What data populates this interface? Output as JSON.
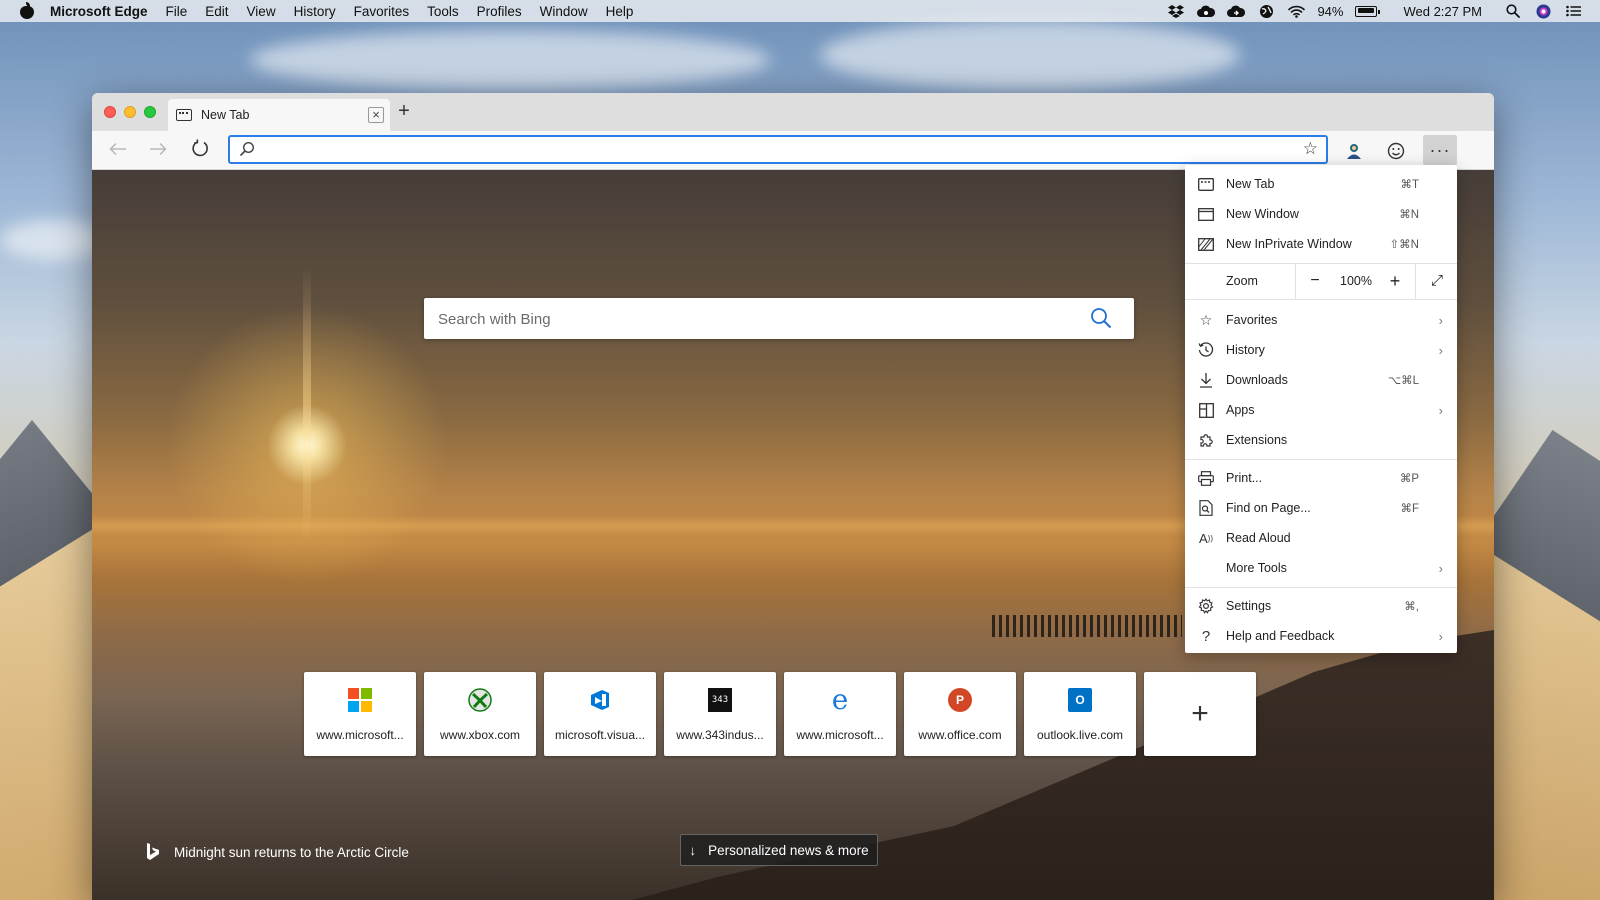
{
  "menubar": {
    "app_name": "Microsoft Edge",
    "items": [
      "File",
      "Edit",
      "View",
      "History",
      "Favorites",
      "Tools",
      "Profiles",
      "Window",
      "Help"
    ],
    "battery": "94%",
    "clock": "Wed 2:27 PM"
  },
  "tab": {
    "title": "New Tab",
    "close": "×",
    "new_tab": "+"
  },
  "address": {
    "value": "",
    "placeholder": ""
  },
  "search": {
    "placeholder": "Search with Bing"
  },
  "tiles": [
    {
      "label": "www.microsoft...",
      "icon": "microsoft-logo-icon"
    },
    {
      "label": "www.xbox.com",
      "icon": "xbox-icon"
    },
    {
      "label": "microsoft.visua...",
      "icon": "visual-studio-icon"
    },
    {
      "label": "www.343indus...",
      "icon": "343-industries-icon",
      "icon_text": "343"
    },
    {
      "label": "www.microsoft...",
      "icon": "edge-icon",
      "icon_text": "e"
    },
    {
      "label": "www.office.com",
      "icon": "powerpoint-icon",
      "icon_text": "P"
    },
    {
      "label": "outlook.live.com",
      "icon": "outlook-icon",
      "icon_text": "O"
    },
    {
      "label": "+",
      "icon": "add-tile-icon"
    }
  ],
  "footer": {
    "image_credit": "Midnight sun returns to the Arctic Circle",
    "news_button": "Personalized news & more",
    "news_icon": "↓"
  },
  "menu": {
    "new_tab": {
      "label": "New Tab",
      "shortcut": "⌘T"
    },
    "new_window": {
      "label": "New Window",
      "shortcut": "⌘N"
    },
    "new_inprivate": {
      "label": "New InPrivate Window",
      "shortcut": "⇧⌘N"
    },
    "zoom": {
      "label": "Zoom",
      "minus": "−",
      "value": "100%",
      "plus": "+",
      "fullscreen": "⤢"
    },
    "favorites": {
      "label": "Favorites",
      "arrow": "›"
    },
    "history": {
      "label": "History",
      "arrow": "›"
    },
    "downloads": {
      "label": "Downloads",
      "shortcut": "⌥⌘L"
    },
    "apps": {
      "label": "Apps",
      "arrow": "›"
    },
    "extensions": {
      "label": "Extensions"
    },
    "print": {
      "label": "Print...",
      "shortcut": "⌘P"
    },
    "find": {
      "label": "Find on Page...",
      "shortcut": "⌘F"
    },
    "read_aloud": {
      "label": "Read Aloud"
    },
    "more_tools": {
      "label": "More Tools",
      "arrow": "›"
    },
    "settings": {
      "label": "Settings",
      "shortcut": "⌘,"
    },
    "help": {
      "label": "Help and Feedback",
      "arrow": "›"
    }
  },
  "colors": {
    "accent": "#2b7de9",
    "traffic_red": "#fe5f57",
    "traffic_yellow": "#febc2e",
    "traffic_green": "#28c840"
  }
}
